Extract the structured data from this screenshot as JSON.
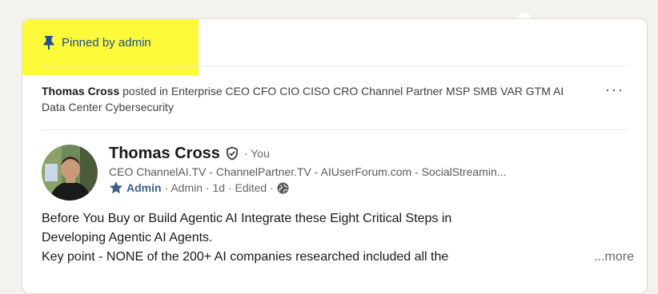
{
  "pinned": {
    "label": "Pinned by admin",
    "highlight_color": "#fdfa3a",
    "icon": "pin-icon"
  },
  "context": {
    "author": "Thomas Cross",
    "action_text": " posted in Enterprise CEO CFO CIO CISO CRO Channel Partner MSP SMB VAR GTM AI Data Center Cybersecurity",
    "more_menu": "···"
  },
  "post_author": {
    "name": "Thomas Cross",
    "verified_icon": "shield-check-icon",
    "degree": "· You",
    "headline": "CEO ChannelAI.TV - ChannelPartner.TV - AIUserForum.com - SocialStreamin...",
    "role_badge": "Admin",
    "meta": "· Admin · 1d · Edited ·",
    "visibility_icon": "globe-icon"
  },
  "post_body": {
    "line1": "Before You Buy or Build Agentic AI Integrate these Eight Critical Steps in",
    "line2": "Developing Agentic AI Agents.",
    "line3": "Key point - NONE of the 200+ AI companies researched included all the",
    "more_label": "...more"
  },
  "colors": {
    "accent_blue": "#1f4f8a",
    "text_primary": "#191919",
    "text_secondary": "#666666"
  }
}
